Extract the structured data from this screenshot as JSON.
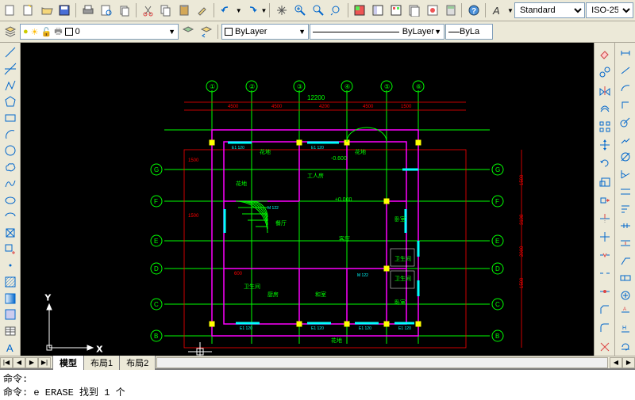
{
  "toolbar_top": {
    "text_style": "Standard",
    "dim_style": "ISO-25"
  },
  "toolbar_layers": {
    "layer_current": "0",
    "color_control": "ByLayer",
    "linetype_control": "ByLayer",
    "lineweight_control": "ByLa"
  },
  "drawing": {
    "ucs": {
      "x_label": "X",
      "y_label": "Y"
    },
    "top_dim": "12200",
    "grid_labels": [
      "①",
      "②",
      "③",
      "④",
      "⑤",
      "⑥"
    ],
    "side_labels": [
      "G",
      "F",
      "E",
      "D",
      "C",
      "B"
    ],
    "rooms": {
      "huadi1": "花地",
      "huadi2": "花地",
      "huadi3": "花地",
      "huadi4": "花地",
      "gongren": "工人房",
      "canting": "餐厅",
      "keting": "客厅",
      "wei1": "卫生间",
      "wei2": "卫生间",
      "wei3": "卫生间",
      "chufang": "厨房",
      "heshi": "和室",
      "woshi1": "卧室",
      "woshi2": "卧室",
      "elev": "±0.000",
      "elev2": "-0.600"
    },
    "dims": {
      "d1": "4500",
      "d2": "4500",
      "d3": "4200",
      "d4": "4500",
      "d5": "1500",
      "d6": "1500",
      "d7": "1500",
      "d8": "3198",
      "d9": "2000",
      "d10": "1500",
      "d11": "600",
      "d12": "1500",
      "d13": "E1 120",
      "d14": "E1 120",
      "d15": "E1 120",
      "d16": "E1 120",
      "d17": "E1 120",
      "d18": "E1 120",
      "d19": "M 122",
      "d20": "M 122"
    }
  },
  "tabs": {
    "model": "模型",
    "layout1": "布局1",
    "layout2": "布局2"
  },
  "command": {
    "line1": "命令:",
    "line2": "命令: e ERASE 找到 1 个"
  }
}
